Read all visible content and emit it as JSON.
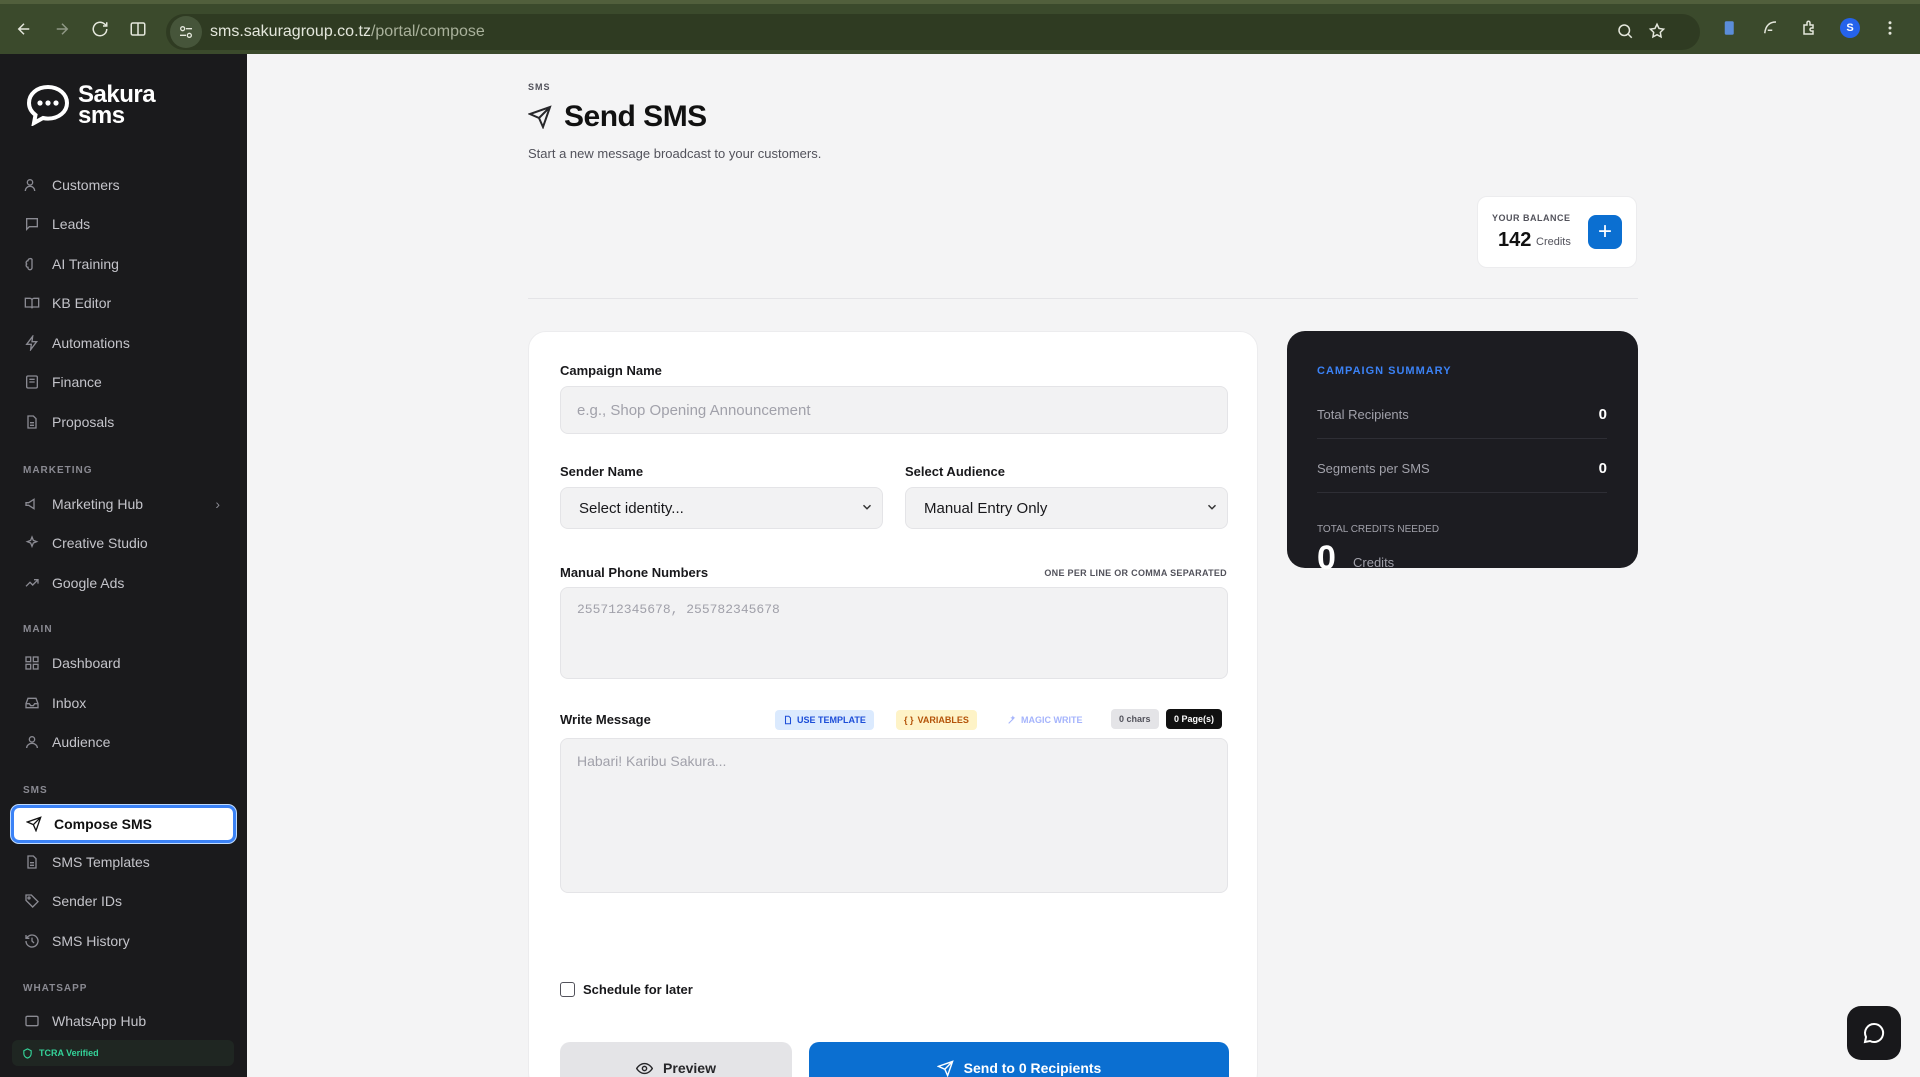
{
  "browser": {
    "url_domain": "sms.sakuragroup.co.tz",
    "url_path": "/portal/compose"
  },
  "sidebar": {
    "logo_line1": "Sakura",
    "logo_line2": "sms",
    "items": [
      {
        "label": "Customers",
        "icon": "users-icon"
      },
      {
        "label": "Leads",
        "icon": "message-square-icon"
      },
      {
        "label": "AI Training",
        "icon": "brain-icon"
      },
      {
        "label": "KB Editor",
        "icon": "book-icon"
      },
      {
        "label": "Automations",
        "icon": "zap-icon"
      },
      {
        "label": "Finance",
        "icon": "receipt-icon"
      },
      {
        "label": "Proposals",
        "icon": "file-text-icon"
      }
    ],
    "sections": {
      "marketing": "MARKETING",
      "main": "MAIN",
      "sms": "SMS",
      "whatsapp": "WHATSAPP"
    },
    "marketing_items": [
      {
        "label": "Marketing Hub",
        "icon": "megaphone-icon"
      },
      {
        "label": "Creative Studio",
        "icon": "sparkles-icon"
      },
      {
        "label": "Google Ads",
        "icon": "trending-up-icon"
      }
    ],
    "main_items": [
      {
        "label": "Dashboard",
        "icon": "grid-icon"
      },
      {
        "label": "Inbox",
        "icon": "inbox-icon"
      },
      {
        "label": "Audience",
        "icon": "user-icon"
      }
    ],
    "sms_items": [
      {
        "label": "Compose SMS",
        "icon": "send-icon"
      },
      {
        "label": "SMS Templates",
        "icon": "file-icon"
      },
      {
        "label": "Sender IDs",
        "icon": "tag-icon"
      },
      {
        "label": "SMS History",
        "icon": "history-icon"
      }
    ],
    "whatsapp_items": [
      {
        "label": "WhatsApp Hub",
        "icon": "message-icon"
      }
    ],
    "verified_label": "TCRA Verified"
  },
  "page": {
    "breadcrumb": "SMS",
    "title": "Send SMS",
    "subtitle": "Start a new message broadcast to your customers."
  },
  "balance": {
    "label": "YOUR BALANCE",
    "value": "142",
    "unit": "Credits",
    "add_label": "+"
  },
  "form": {
    "campaign_label": "Campaign Name",
    "campaign_placeholder": "e.g., Shop Opening Announcement",
    "sender_label": "Sender Name",
    "sender_value": "Select identity...",
    "audience_label": "Select Audience",
    "audience_value": "Manual Entry Only",
    "phones_label": "Manual Phone Numbers",
    "phones_hint": "ONE PER LINE OR COMMA SEPARATED",
    "phones_placeholder": "255712345678, 255782345678",
    "message_label": "Write Message",
    "use_template": "USE TEMPLATE",
    "variables": "VARIABLES",
    "magic_write": "MAGIC WRITE",
    "chars": "0 chars",
    "pages": "0 Page(s)",
    "message_placeholder": "Habari! Karibu Sakura...",
    "schedule_label": "Schedule for later",
    "preview_label": "Preview",
    "send_label": "Send to 0 Recipients"
  },
  "summary": {
    "title": "CAMPAIGN SUMMARY",
    "recipients_label": "Total Recipients",
    "recipients_value": "0",
    "segments_label": "Segments per SMS",
    "segments_value": "0",
    "credits_label": "TOTAL CREDITS NEEDED",
    "credits_value": "0",
    "credits_unit": "Credits"
  },
  "colors": {
    "accent": "#0b6fd1",
    "sidebar_bg": "#1a1a1c",
    "summary_bg": "#1c1c21",
    "page_bg": "#f4f4f5"
  }
}
